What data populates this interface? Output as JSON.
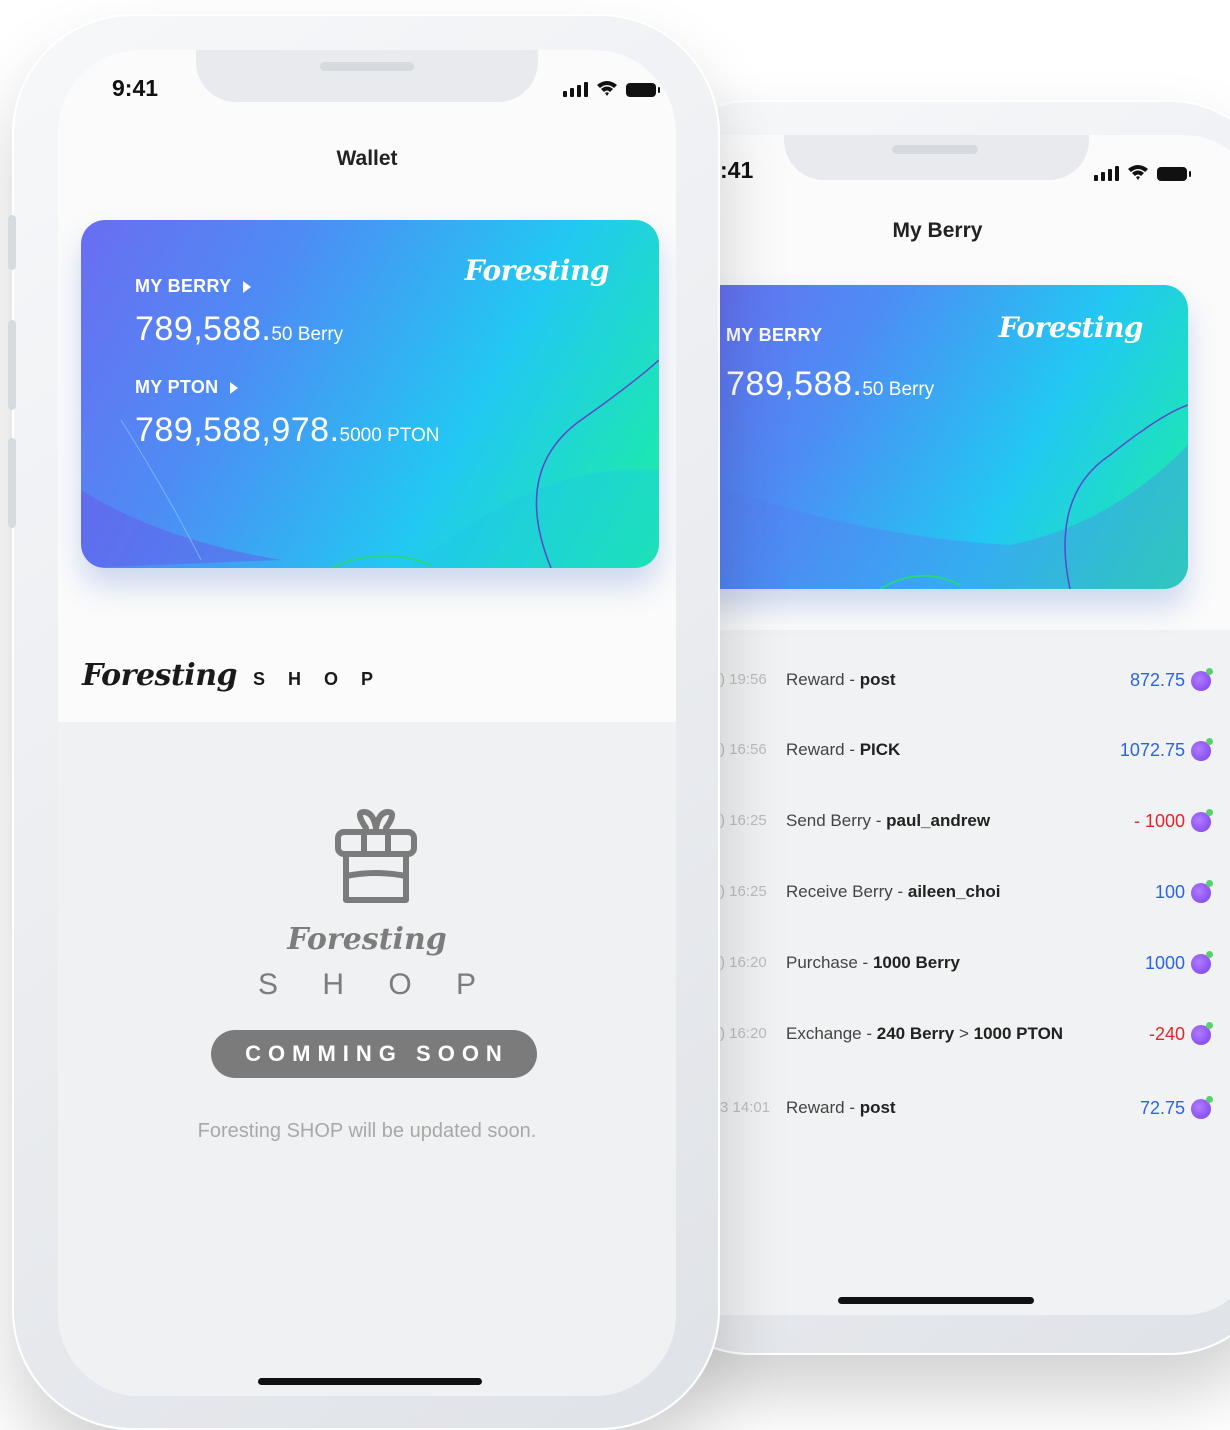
{
  "colors": {
    "positive": "#2a64e6",
    "negative": "#e4242a",
    "muted": "#7b7b7b"
  },
  "icons": {
    "gift": "gift-icon",
    "berry": "berry-icon"
  },
  "wallet": {
    "status_time": "9:41",
    "title": "Wallet",
    "card": {
      "brand": "Foresting",
      "berry_label": "MY BERRY",
      "berry_value_big": "789,588.",
      "berry_value_small": "50 Berry",
      "pton_label": "MY PTON",
      "pton_value_big": "789,588,978.",
      "pton_value_small": "5000 PTON"
    },
    "shop": {
      "brand": "Foresting",
      "title": "S H O P",
      "placeholder_brand": "Foresting",
      "placeholder_title": "S H O P",
      "coming_soon": "COMMING SOON",
      "note": "Foresting SHOP will be updated soon."
    }
  },
  "my_berry": {
    "status_time": ":41",
    "title": "My Berry",
    "card": {
      "brand": "Foresting",
      "label": "MY BERRY",
      "value_big": "789,588.",
      "value_small": "50 Berry"
    },
    "transactions": [
      {
        "time": ") 19:56",
        "type": "Reward",
        "detail": "post",
        "amount": "872.75",
        "sign": "positive"
      },
      {
        "time": ") 16:56",
        "type": "Reward",
        "detail": "PICK",
        "amount": "1072.75",
        "sign": "positive"
      },
      {
        "time": ") 16:25",
        "type": "Send Berry",
        "detail": "paul_andrew",
        "amount": "- 1000",
        "sign": "negative"
      },
      {
        "time": ") 16:25",
        "type": "Receive Berry",
        "detail": "aileen_choi",
        "amount": "100",
        "sign": "positive"
      },
      {
        "time": ") 16:20",
        "type": "Purchase",
        "detail": "1000 Berry",
        "amount": "1000",
        "sign": "positive"
      },
      {
        "time": ") 16:20",
        "type": "Exchange",
        "detail": "240 Berry",
        "detail2": "1000 PTON",
        "amount": "-240",
        "sign": "negative"
      },
      {
        "time": "3 14:01",
        "type": "Reward",
        "detail": "post",
        "amount": "72.75",
        "sign": "positive"
      }
    ]
  }
}
